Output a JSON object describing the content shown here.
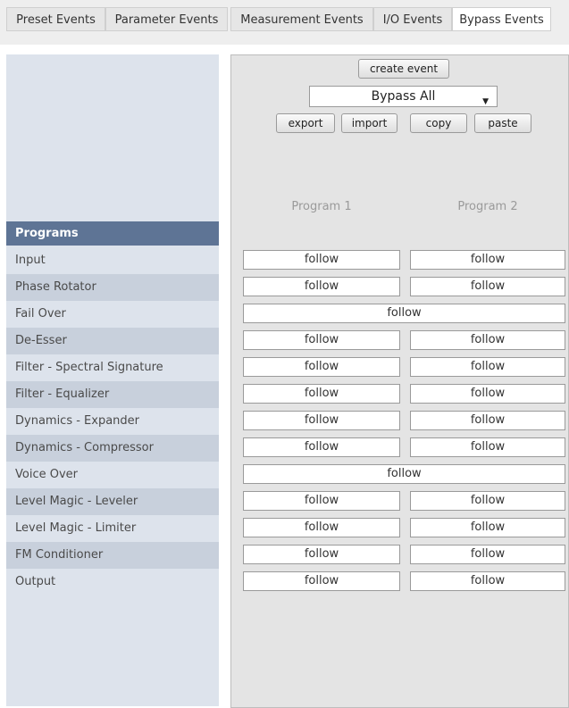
{
  "tabs": [
    {
      "label": "Preset Events",
      "active": false
    },
    {
      "label": "Parameter Events",
      "active": false
    },
    {
      "label": "Measurement Events",
      "active": false
    },
    {
      "label": "I/O Events",
      "active": false
    },
    {
      "label": "Bypass Events",
      "active": true
    }
  ],
  "toolbar": {
    "create_label": "create event",
    "selected_event": "Bypass All",
    "export_label": "export",
    "import_label": "import",
    "copy_label": "copy",
    "paste_label": "paste"
  },
  "columns": {
    "program1": "Program 1",
    "program2": "Program 2"
  },
  "programs_header": "Programs",
  "rows": [
    {
      "label": "Input",
      "p1": "follow",
      "p2": "follow"
    },
    {
      "label": "Phase Rotator",
      "p1": "follow",
      "p2": "follow"
    },
    {
      "label": "Fail Over",
      "merged": "follow"
    },
    {
      "label": "De-Esser",
      "p1": "follow",
      "p2": "follow"
    },
    {
      "label": "Filter - Spectral Signature",
      "p1": "follow",
      "p2": "follow"
    },
    {
      "label": "Filter - Equalizer",
      "p1": "follow",
      "p2": "follow"
    },
    {
      "label": "Dynamics - Expander",
      "p1": "follow",
      "p2": "follow"
    },
    {
      "label": "Dynamics - Compressor",
      "p1": "follow",
      "p2": "follow"
    },
    {
      "label": "Voice Over",
      "merged": "follow"
    },
    {
      "label": "Level Magic - Leveler",
      "p1": "follow",
      "p2": "follow"
    },
    {
      "label": "Level Magic - Limiter",
      "p1": "follow",
      "p2": "follow"
    },
    {
      "label": "FM Conditioner",
      "p1": "follow",
      "p2": "follow"
    },
    {
      "label": "Output",
      "p1": "follow",
      "p2": "follow"
    }
  ]
}
